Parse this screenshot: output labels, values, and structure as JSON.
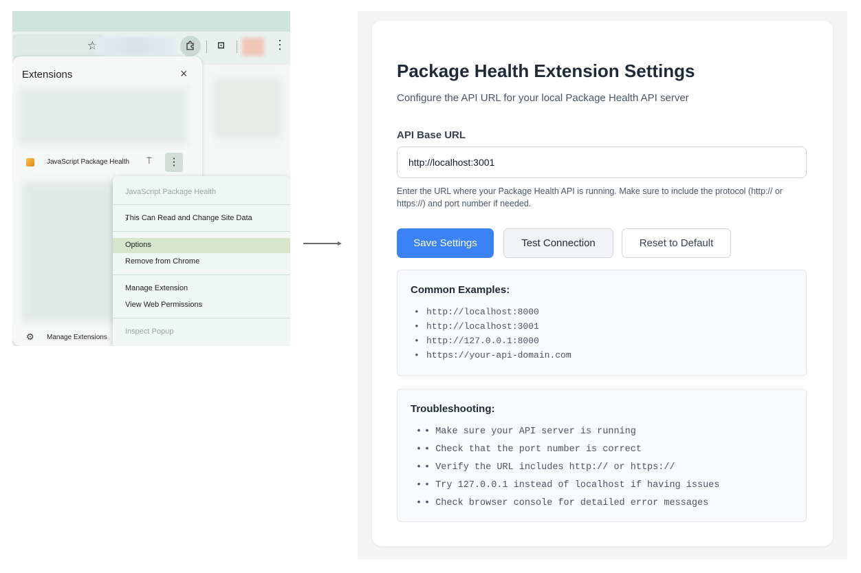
{
  "left": {
    "panel_title": "Extensions",
    "extension_name": "JavaScript Package Health",
    "manage_extensions": "Manage Extensions",
    "context_menu": {
      "header": "JavaScript Package Health",
      "site_data": "This Can Read and Change Site Data",
      "options": "Options",
      "remove": "Remove from Chrome",
      "manage": "Manage Extension",
      "permissions": "View Web Permissions",
      "inspect": "Inspect Popup"
    }
  },
  "settings": {
    "title": "Package Health Extension Settings",
    "subtitle": "Configure the API URL for your local Package Health API server",
    "api_label": "API Base URL",
    "api_value": "http://localhost:3001",
    "help_text": "Enter the URL where your Package Health API is running. Make sure to include the protocol (http:// or https://) and port number if needed.",
    "buttons": {
      "save": "Save Settings",
      "test": "Test Connection",
      "reset": "Reset to Default"
    },
    "examples": {
      "title": "Common Examples:",
      "items": [
        "http://localhost:8000",
        "http://localhost:3001",
        "http://127.0.0.1:8000",
        "https://your-api-domain.com"
      ]
    },
    "troubleshooting": {
      "title": "Troubleshooting:",
      "items": [
        "• Make sure your API server is running",
        "• Check that the port number is correct",
        "• Verify the URL includes http:// or https://",
        "• Try 127.0.0.1 instead of localhost if having issues",
        "• Check browser console for detailed error messages"
      ]
    }
  },
  "colors": {
    "primary": "#3b82f6",
    "highlight": "#d6e6cd",
    "browser_band": "#cfe3dc"
  }
}
